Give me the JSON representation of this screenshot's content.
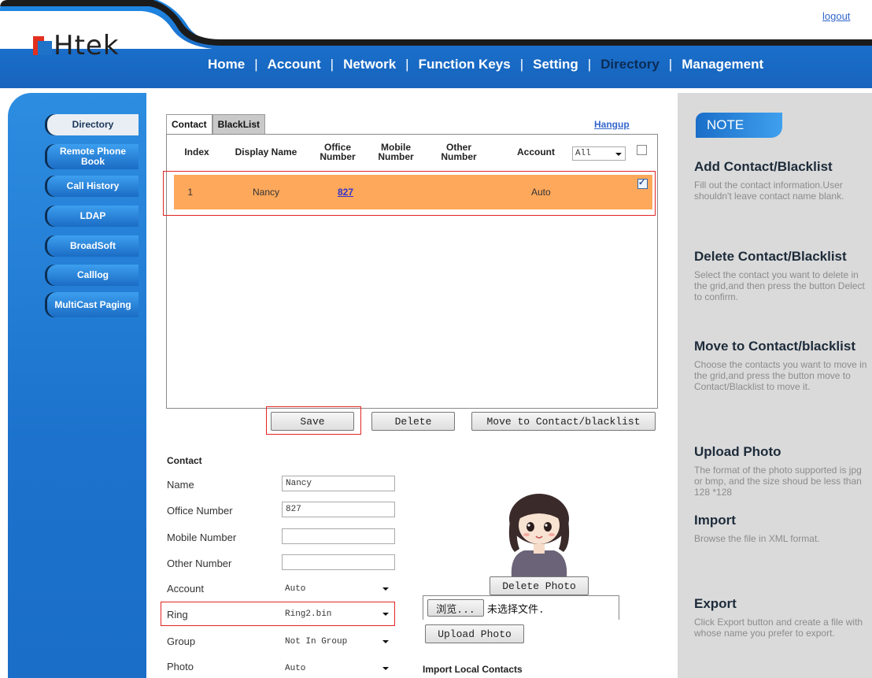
{
  "header": {
    "logout": "logout",
    "logo_text": "Htek",
    "nav": [
      "Home",
      "Account",
      "Network",
      "Function Keys",
      "Setting",
      "Directory",
      "Management"
    ],
    "nav_active": "Directory"
  },
  "sidebar": {
    "items": [
      {
        "label": "Directory"
      },
      {
        "label": "Remote Phone Book"
      },
      {
        "label": "Call History"
      },
      {
        "label": "LDAP"
      },
      {
        "label": "BroadSoft"
      },
      {
        "label": "Calllog"
      },
      {
        "label": "MultiCast Paging"
      }
    ]
  },
  "tabs": {
    "contact": "Contact",
    "blacklist": "BlackList"
  },
  "hangup": "Hangup",
  "grid": {
    "headers": {
      "index": "Index",
      "display_name": "Display Name",
      "office_number": "Office Number",
      "mobile_number": "Mobile Number",
      "other_number": "Other Number",
      "account": "Account"
    },
    "account_filter": "All",
    "header_checked": false,
    "rows": [
      {
        "index": "1",
        "display_name": "Nancy",
        "office_number": "827",
        "mobile_number": "",
        "other_number": "",
        "account": "Auto",
        "checked": true
      }
    ]
  },
  "buttons": {
    "save": "Save",
    "delete": "Delete",
    "move": "Move to Contact/blacklist",
    "delete_photo": "Delete Photo",
    "browse": "浏览...",
    "upload_photo": "Upload Photo"
  },
  "file": {
    "status": "未选择文件."
  },
  "contact_form": {
    "section": "Contact",
    "name_label": "Name",
    "name_value": "Nancy",
    "office_label": "Office Number",
    "office_value": "827",
    "mobile_label": "Mobile Number",
    "mobile_value": "",
    "other_label": "Other Number",
    "other_value": "",
    "account_label": "Account",
    "account_value": "Auto",
    "ring_label": "Ring",
    "ring_value": "Ring2.bin",
    "group_label": "Group",
    "group_value": "Not In Group",
    "photo_label": "Photo",
    "photo_value": "Auto"
  },
  "import_local": "Import Local Contacts",
  "note": {
    "badge": "NOTE",
    "sections": [
      {
        "title": "Add Contact/Blacklist",
        "text": "Fill out the contact information.User shouldn't leave contact name blank."
      },
      {
        "title": "Delete Contact/Blacklist",
        "text": "Select the contact you want to delete in the grid,and then press the button Delect to confirm."
      },
      {
        "title": "Move to Contact/blacklist",
        "text": "Choose the contacts you want to move in the grid,and press the button move to Contact/Blacklist to move it."
      },
      {
        "title": "Upload Photo",
        "text": "The format of the photo supported is jpg or bmp, and the size shoud be less than 128 *128"
      },
      {
        "title": "Import",
        "text": "Browse the file in XML format."
      },
      {
        "title": "Export",
        "text": "Click Export button and create a file with whose name you prefer to export."
      }
    ]
  },
  "colors": {
    "brand_blue": "#1e73c8",
    "row_highlight": "#fda85b",
    "annotation_red": "#e22424",
    "note_panel": "#dadada"
  }
}
